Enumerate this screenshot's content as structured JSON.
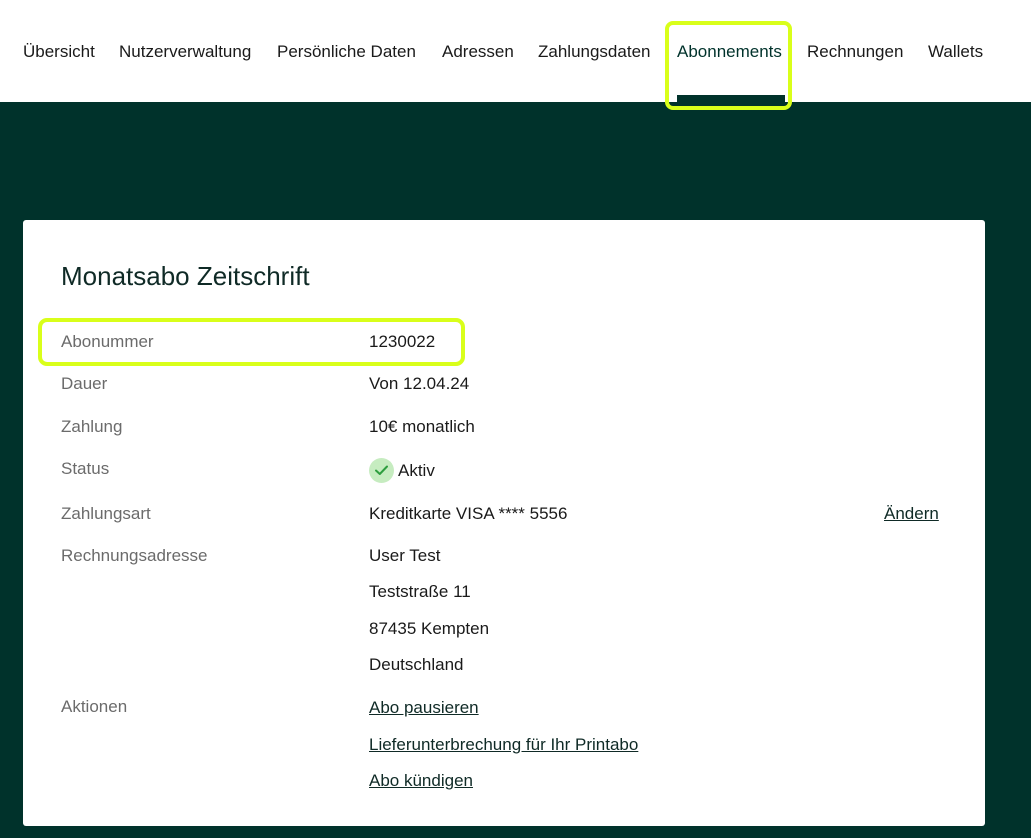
{
  "nav": {
    "tabs": [
      {
        "label": "Übersicht"
      },
      {
        "label": "Nutzerverwaltung"
      },
      {
        "label": "Persönliche Daten"
      },
      {
        "label": "Adressen"
      },
      {
        "label": "Zahlungsdaten"
      },
      {
        "label": "Abonnements",
        "active": true
      },
      {
        "label": "Rechnungen"
      },
      {
        "label": "Wallets"
      }
    ]
  },
  "subscription": {
    "title": "Monatsabo Zeitschrift",
    "fields": {
      "abonummer": {
        "label": "Abonummer",
        "value": "1230022"
      },
      "dauer": {
        "label": "Dauer",
        "value": "Von 12.04.24"
      },
      "zahlung": {
        "label": "Zahlung",
        "value": "10€ monatlich"
      },
      "status": {
        "label": "Status",
        "value": "Aktiv",
        "icon": "check-circle-icon"
      },
      "zahlungsart": {
        "label": "Zahlungsart",
        "value": "Kreditkarte VISA **** 5556",
        "action_label": "Ändern"
      },
      "rechnungsadresse": {
        "label": "Rechnungsadresse",
        "lines": [
          "User Test",
          "Teststraße 11",
          "87435 Kempten",
          "Deutschland"
        ]
      },
      "aktionen": {
        "label": "Aktionen",
        "links": [
          "Abo pausieren",
          "Lieferunterbrechung für Ihr Printabo",
          "Abo kündigen"
        ]
      }
    }
  },
  "colors": {
    "background": "#00322b",
    "highlight": "#d9ff1a",
    "status_badge": "#c6ecc0",
    "status_check": "#2e9e3f"
  }
}
